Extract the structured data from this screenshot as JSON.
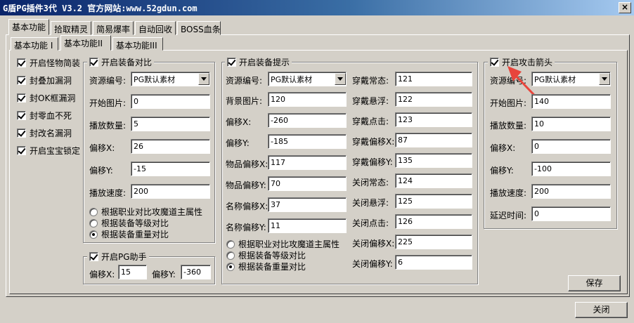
{
  "window": {
    "title": "G盾PG插件3代  V3.2   官方网站:www.52gdun.com",
    "close_glyph": "×"
  },
  "tabs": [
    "基本功能",
    "拾取精灵",
    "简易爆率",
    "自动回收",
    "BOSS血条"
  ],
  "subtabs": [
    "基本功能 I",
    "基本功能II",
    "基本功能III"
  ],
  "left_checks": [
    {
      "label": "开启怪物简装",
      "checked": true
    },
    {
      "label": "封叠加漏洞",
      "checked": true
    },
    {
      "label": "封OK框漏洞",
      "checked": true
    },
    {
      "label": "封零血不死",
      "checked": true
    },
    {
      "label": "封改名漏洞",
      "checked": true
    },
    {
      "label": "开启宝宝锁定",
      "checked": true
    }
  ],
  "compare": {
    "title": "开启装备对比",
    "res_label": "资源编号:",
    "res_value": "PG默认素材",
    "fields": [
      {
        "label": "开始图片:",
        "value": "0"
      },
      {
        "label": "播放数量:",
        "value": "5"
      },
      {
        "label": "偏移X:",
        "value": "26"
      },
      {
        "label": "偏移Y:",
        "value": "-15"
      },
      {
        "label": "播放速度:",
        "value": "200"
      }
    ],
    "radios": [
      {
        "label": "根据职业对比攻魔道主属性",
        "on": false
      },
      {
        "label": "根据装备等级对比",
        "on": false
      },
      {
        "label": "根据装备重量对比",
        "on": true
      }
    ]
  },
  "pg_helper": {
    "title": "开启PG助手",
    "x_label": "偏移X:",
    "x_value": "15",
    "y_label": "偏移Y:",
    "y_value": "-360"
  },
  "tips": {
    "title": "开启装备提示",
    "res_label": "资源编号:",
    "res_value": "PG默认素材",
    "left_fields": [
      {
        "label": "背景图片:",
        "value": "120"
      },
      {
        "label": "偏移X:",
        "value": "-260"
      },
      {
        "label": "偏移Y:",
        "value": "-185"
      },
      {
        "label": "物品偏移X:",
        "value": "117"
      },
      {
        "label": "物品偏移Y:",
        "value": "70"
      },
      {
        "label": "名称偏移X:",
        "value": "37"
      },
      {
        "label": "名称偏移Y:",
        "value": "11"
      }
    ],
    "right_fields": [
      {
        "label": "穿戴常态:",
        "value": "121"
      },
      {
        "label": "穿戴悬浮:",
        "value": "122"
      },
      {
        "label": "穿戴点击:",
        "value": "123"
      },
      {
        "label": "穿戴偏移X:",
        "value": "87"
      },
      {
        "label": "穿戴偏移Y:",
        "value": "135"
      },
      {
        "label": "关闭常态:",
        "value": "124"
      },
      {
        "label": "关闭悬浮:",
        "value": "125"
      },
      {
        "label": "关闭点击:",
        "value": "126"
      },
      {
        "label": "关闭偏移X:",
        "value": "225"
      },
      {
        "label": "关闭偏移Y:",
        "value": "6"
      }
    ],
    "radios": [
      {
        "label": "根据职业对比攻魔道主属性",
        "on": false
      },
      {
        "label": "根据装备等级对比",
        "on": false
      },
      {
        "label": "根据装备重量对比",
        "on": true
      }
    ]
  },
  "arrow": {
    "title": "开启攻击箭头",
    "res_label": "资源编号:",
    "res_value": "PG默认素材",
    "fields": [
      {
        "label": "开始图片:",
        "value": "140"
      },
      {
        "label": "播放数量:",
        "value": "10"
      },
      {
        "label": "偏移X:",
        "value": "0"
      },
      {
        "label": "偏移Y:",
        "value": "-100"
      },
      {
        "label": "播放速度:",
        "value": "200"
      },
      {
        "label": "延迟时间:",
        "value": "0"
      }
    ]
  },
  "buttons": {
    "save": "保存",
    "close": "关闭"
  },
  "colors": {
    "titlebar": "#0a246a",
    "face": "#d4d0c8",
    "annotation_arrow": "#e8453c"
  }
}
